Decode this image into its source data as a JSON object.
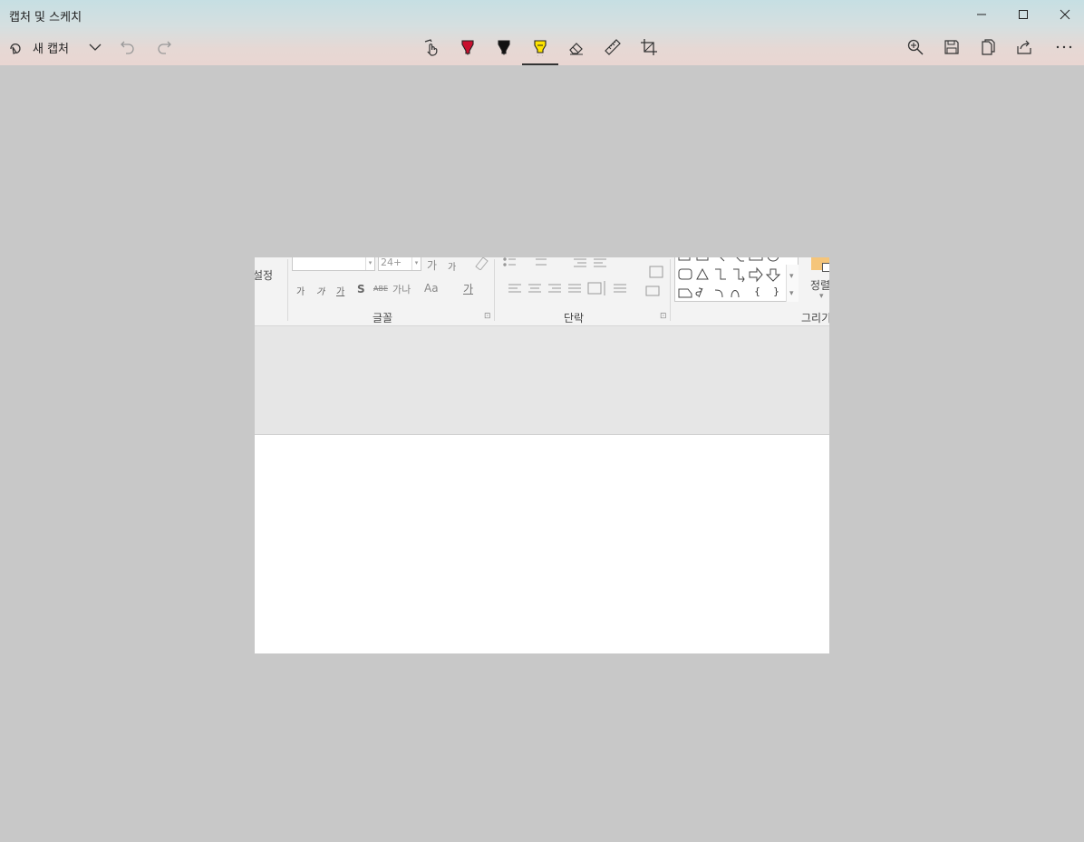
{
  "window": {
    "title": "캡처 및 스케치"
  },
  "toolbar": {
    "new_capture_label": "새 캡처",
    "tools": [
      {
        "name": "touch-writing",
        "icon": "touch-writing-icon"
      },
      {
        "name": "ballpoint-pen",
        "icon": "ballpoint-pen-icon",
        "color": "#c8102e"
      },
      {
        "name": "pencil",
        "icon": "pencil-icon",
        "color": "#111111"
      },
      {
        "name": "highlighter",
        "icon": "highlighter-icon",
        "color": "#ffe400",
        "selected": true
      },
      {
        "name": "eraser",
        "icon": "eraser-icon"
      },
      {
        "name": "ruler",
        "icon": "ruler-icon"
      },
      {
        "name": "crop",
        "icon": "crop-icon"
      }
    ],
    "right": [
      "zoom-icon",
      "save-icon",
      "copy-icon",
      "share-icon",
      "more-icon"
    ]
  },
  "captured": {
    "left_edge_label": "설정",
    "font_size_value": "24+",
    "group_font": "글꼴",
    "group_paragraph": "단락",
    "group_drawing": "그리기",
    "arrange_label": "정렬",
    "grow_font": "가",
    "shrink_font": "가",
    "font_btn1": "가",
    "font_btn2": "가",
    "font_btn3": "가",
    "shadow_btn": "S",
    "strike_btn": "ABE",
    "spacing_btn": "가나",
    "case_btn": "Aa",
    "color_btn": "가",
    "shape_brace_open": "{",
    "shape_brace_close": "}"
  },
  "colors": {
    "canvas_background": "#c8c8c8",
    "ribbon_background": "#f3f3f3",
    "slide_area": "#e6e6e6"
  }
}
